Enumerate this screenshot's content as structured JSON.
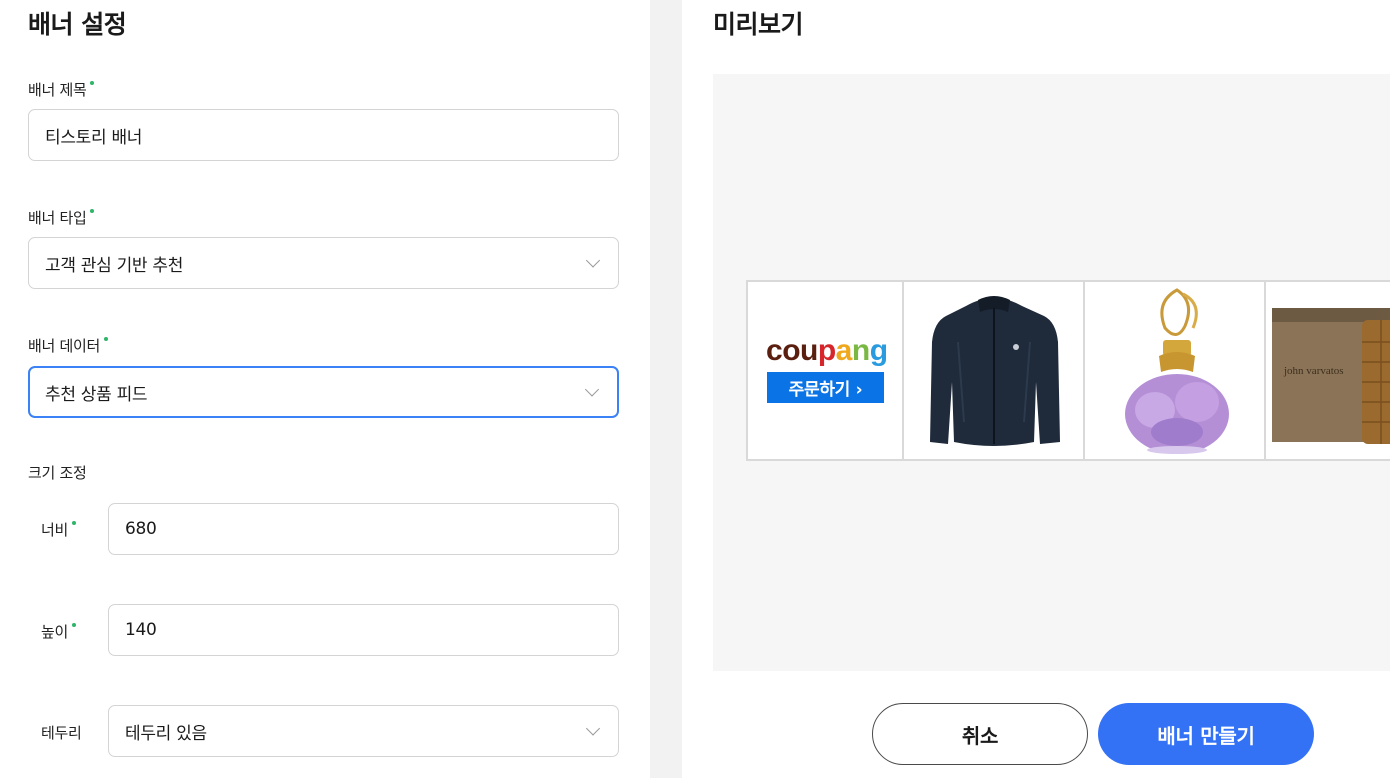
{
  "settings": {
    "title": "배너 설정",
    "banner_title": {
      "label": "배너 제목",
      "value": "티스토리 배너"
    },
    "banner_type": {
      "label": "배너 타입",
      "value": "고객 관심 기반 추천"
    },
    "banner_data": {
      "label": "배너 데이터",
      "value": "추천 상품 피드"
    },
    "size_label": "크기 조정",
    "width": {
      "label": "너비",
      "value": "680"
    },
    "height": {
      "label": "높이",
      "value": "140"
    },
    "border": {
      "label": "테두리",
      "value": "테두리 있음"
    }
  },
  "preview": {
    "title": "미리보기",
    "coupang_logo": [
      "c",
      "o",
      "u",
      "p",
      "a",
      "n",
      "g"
    ],
    "coupang_colors": [
      "#5a1f0f",
      "#5a1f0f",
      "#5a1f0f",
      "#d6252b",
      "#f0a81c",
      "#79b843",
      "#2b9be0"
    ],
    "order_button": "주문하기 ›",
    "products": [
      "jacket-image",
      "perfume-bottle-image",
      "cologne-box-image"
    ],
    "cologne_brand": "john varvatos"
  },
  "actions": {
    "cancel": "취소",
    "create": "배너 만들기"
  },
  "colors": {
    "accent": "#3472f5",
    "required_dot": "#2fb56a",
    "focus_border": "#3b82f6"
  }
}
